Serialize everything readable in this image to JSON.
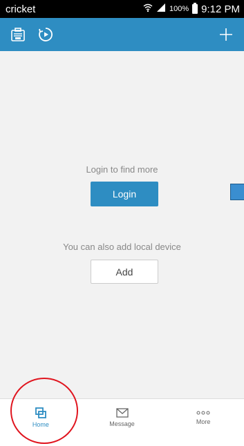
{
  "status_bar": {
    "carrier": "cricket",
    "battery_percent": "100%",
    "time": "9:12 PM",
    "icons": [
      "wifi-icon",
      "signal-icon",
      "battery-icon"
    ]
  },
  "app_bar": {
    "icons": [
      "device-list-icon",
      "playback-icon",
      "plus-icon"
    ],
    "color": "#2e8dc2"
  },
  "main": {
    "login_prompt": "Login to find more",
    "login_button_label": "Login",
    "local_prompt": "You can also add local device",
    "add_button_label": "Add"
  },
  "bottom_nav": {
    "items": [
      {
        "label": "Home",
        "icon": "home-icon",
        "active": true
      },
      {
        "label": "Message",
        "icon": "message-icon",
        "active": false
      },
      {
        "label": "More",
        "icon": "more-icon",
        "active": false
      }
    ]
  },
  "colors": {
    "accent": "#2e8dc2",
    "highlight": "#e0141e"
  }
}
